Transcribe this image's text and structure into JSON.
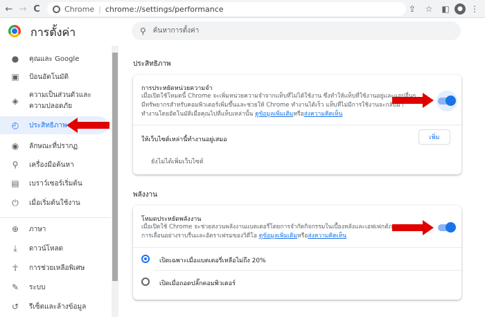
{
  "toolbar": {
    "back_icon": "←",
    "forward_icon": "→",
    "reload_icon": "C",
    "chrome_label": "Chrome",
    "separator": "|",
    "url": "chrome://settings/performance",
    "share_icon": "⇪",
    "star_icon": "☆",
    "sidepanel_icon": "◧",
    "menu_icon": "⋮"
  },
  "header": {
    "title": "การตั้งค่า",
    "search_placeholder": "ค้นหาการตั้งค่า"
  },
  "sidebar": {
    "items": [
      {
        "label": "คุณและ Google",
        "icon": "person-icon",
        "glyph": "👤"
      },
      {
        "label": "ป้อนอัตโนมัติ",
        "icon": "clipboard-icon",
        "glyph": "📋"
      },
      {
        "label": "ความเป็นส่วนตัวและความปลอดภัย",
        "icon": "shield-icon",
        "glyph": "🛡"
      },
      {
        "label": "ประสิทธิภาพ",
        "icon": "speedometer-icon",
        "glyph": "◴"
      },
      {
        "label": "ลักษณะที่ปรากฏ",
        "icon": "palette-icon",
        "glyph": "🎨"
      },
      {
        "label": "เครื่องมือค้นหา",
        "icon": "search-icon",
        "glyph": "⚲"
      },
      {
        "label": "เบราว์เซอร์เริ่มต้น",
        "icon": "browser-icon",
        "glyph": "▤"
      },
      {
        "label": "เมื่อเริ่มต้นใช้งาน",
        "icon": "power-icon",
        "glyph": "⏻"
      },
      {
        "label": "ภาษา",
        "icon": "globe-icon",
        "glyph": "🌐"
      },
      {
        "label": "ดาวน์โหลด",
        "icon": "download-icon",
        "glyph": "⤓"
      },
      {
        "label": "การช่วยเหลือพิเศษ",
        "icon": "accessibility-icon",
        "glyph": "♿"
      },
      {
        "label": "ระบบ",
        "icon": "wrench-icon",
        "glyph": "🔧"
      },
      {
        "label": "รีเซ็ตและล้างข้อมูล",
        "icon": "reset-icon",
        "glyph": "↺"
      }
    ]
  },
  "performance": {
    "section_title": "ประสิทธิภาพ",
    "memory_saver_title": "การประหยัดหน่วยความจำ",
    "memory_saver_desc": "เมื่อเปิดใช้โหมดนี้ Chrome จะเพิ่มหน่วยความจำจากแท็บที่ไม่ได้ใช้งาน ซึ่งทำให้แท็บที่ใช้งานอยู่และแอปอื่นๆ มีทรัพยากรสำหรับคอมพิวเตอร์เพิ่มขึ้นและช่วยให้ Chrome ทำงานได้เร็ว แท็บที่ไม่มีการใช้งานจะกลับมาทำงานโดยอัตโนมัติเมื่อคุณไปที่แท็บเหล่านั้น",
    "memory_saver_link": "ดูข้อมูลเพิ่มเติม",
    "memory_saver_or": "หรือ",
    "memory_saver_feedback": "ส่งความคิดเห็น",
    "memory_saver_on": true,
    "always_active_title": "ให้เว็บไซต์เหล่านี้ทำงานอยู่เสมอ",
    "add_button": "เพิ่ม",
    "no_sites": "ยังไม่ได้เพิ่มเว็บไซต์"
  },
  "energy": {
    "section_title": "พลังงาน",
    "energy_saver_title": "โหมดประหยัดพลังงาน",
    "energy_saver_desc": "เมื่อเปิดใช้ Chrome จะช่วยสงวนพลังงานแบตเตอรี่โดยการจำกัดกิจกรรมในเบื้องหลังและเอฟเฟกต์ภาพ เช่น การเลื่อนอย่างราบรื่นและอัตราเฟรมของวิดีโอ",
    "energy_saver_link": "ดูข้อมูลเพิ่มเติม",
    "energy_saver_or": "หรือ",
    "energy_saver_feedback": "ส่งความคิดเห็น",
    "energy_saver_on": true,
    "options": [
      {
        "label": "เปิดเฉพาะเมื่อแบตเตอรี่เหลือไม่ถึง 20%",
        "selected": true
      },
      {
        "label": "เปิดเมื่อถอดปลั๊กคอมพิวเตอร์",
        "selected": false
      }
    ]
  },
  "colors": {
    "accent": "#1a73e8",
    "annotation_arrow": "#e00000"
  }
}
